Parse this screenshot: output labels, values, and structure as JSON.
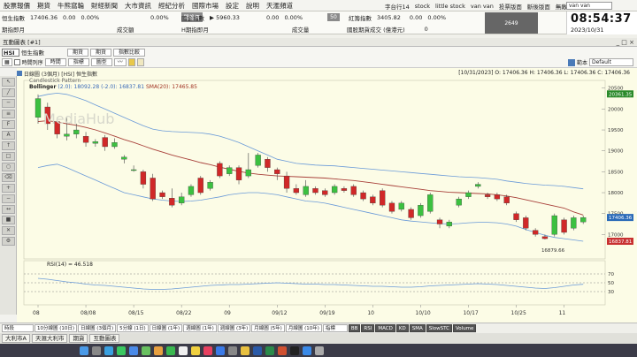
{
  "menu": {
    "items": [
      "股票報價",
      "期貨",
      "牛熊窩輪",
      "財經新聞",
      "大市資訊",
      "經紀分析",
      "國際市場",
      "設定",
      "說明",
      "天滙頻道"
    ],
    "right_items": [
      "字台行14",
      "stock",
      "little stock",
      "van van",
      "投票版面",
      "斷後版面",
      "無敵版面"
    ],
    "search_value": "van van"
  },
  "quotes": {
    "row1": {
      "index_name": "恒生指數",
      "last": "17406.36",
      "change": "0.00",
      "pct": "0.00%",
      "pct2": "0.00%",
      "pre_label": "開盤價",
      "futures_label": "國企指數",
      "futures_value": "▶ 5960.33",
      "f_change": "0.00",
      "f_pct": "0.00%",
      "vol_badge": "50",
      "red_label": "紅籌指數",
      "red_value": "3405.82",
      "r_change": "0.00",
      "r_pct": "0.00%"
    },
    "row2": {
      "label1": "期指即月",
      "amount_label": "成交額",
      "label2": "H期指即月",
      "vol_label": "成交量",
      "label3": "國股期貨成交 (億港元)",
      "value3": "0"
    },
    "dark_value": "2649"
  },
  "clock": {
    "time": "08:54:37",
    "date": "2023/10/31"
  },
  "window": {
    "title": "互動圖表 [#1]",
    "controls": "_ □ ×"
  },
  "toolbar": {
    "symbol": "HSI",
    "name": "恒生指數",
    "btn1": "期貨",
    "btn2": "期貨",
    "btn3": "指數比較",
    "time_axis": "時間列序",
    "b_time": "時間",
    "b_indicator": "指標",
    "b_chart": "圖型",
    "right_label": "範本",
    "template": "Default"
  },
  "chart": {
    "header_left": "日線圖 (3個月)",
    "header_code": "[HSI] 恒生指數",
    "ohlc": "[10/31/2023]  O: 17406.36  H: 17406.36  L: 17406.36  C: 17406.36",
    "sub": "Candlestick Pattern",
    "boll_label": "Bollinger",
    "boll_upper": "(2.0): 18092.28",
    "boll_lower": "(-2.0): 16837.81",
    "sma_label": "SMA(20): 17465.85",
    "watermark": "MediaHub",
    "low_annot": "16879.66",
    "rsi_label": "RSI(14) = 46.518"
  },
  "chart_data": {
    "type": "candlestick",
    "x_labels": [
      "08",
      "08/08",
      "08/15",
      "08/22",
      "09",
      "09/12",
      "09/19",
      "10",
      "10/10",
      "10/17",
      "10/25",
      "11"
    ],
    "y_ticks": [
      20500,
      20000,
      19500,
      19000,
      18500,
      18000,
      17500,
      17000
    ],
    "ylim": [
      16500,
      20600
    ],
    "price_tags": [
      {
        "value": "20361.35",
        "color": "#2a8a2a"
      },
      {
        "value": "17406.36",
        "color": "#2a6ab8"
      },
      {
        "value": "16837.81",
        "color": "#c83030"
      }
    ],
    "candles": [
      {
        "o": 19800,
        "c": 20250,
        "h": 20350,
        "l": 19650
      },
      {
        "o": 20050,
        "c": 19650,
        "h": 20150,
        "l": 19500
      },
      {
        "o": 19700,
        "c": 19400,
        "h": 19800,
        "l": 19300
      },
      {
        "o": 19350,
        "c": 19400,
        "h": 19800,
        "l": 19250
      },
      {
        "o": 19400,
        "c": 19500,
        "h": 19650,
        "l": 19300
      },
      {
        "o": 19350,
        "c": 19200,
        "h": 19450,
        "l": 19100
      },
      {
        "o": 19180,
        "c": 19220,
        "h": 19280,
        "l": 19100
      },
      {
        "o": 19320,
        "c": 19100,
        "h": 19380,
        "l": 19000
      },
      {
        "o": 19100,
        "c": 19200,
        "h": 19300,
        "l": 19050
      },
      {
        "o": 18800,
        "c": 18850,
        "h": 18900,
        "l": 18700
      },
      {
        "o": 18550,
        "c": 18550,
        "h": 18650,
        "l": 18500
      },
      {
        "o": 18500,
        "c": 18200,
        "h": 18550,
        "l": 18100
      },
      {
        "o": 18350,
        "c": 17850,
        "h": 18450,
        "l": 17800
      },
      {
        "o": 18000,
        "c": 17900,
        "h": 18050,
        "l": 17850
      },
      {
        "o": 17870,
        "c": 17700,
        "h": 18100,
        "l": 17650
      },
      {
        "o": 17750,
        "c": 17900,
        "h": 18000,
        "l": 17700
      },
      {
        "o": 17950,
        "c": 18150,
        "h": 18200,
        "l": 17900
      },
      {
        "o": 18350,
        "c": 18000,
        "h": 18400,
        "l": 17950
      },
      {
        "o": 18100,
        "c": 18250,
        "h": 18300,
        "l": 18050
      },
      {
        "o": 18700,
        "c": 18400,
        "h": 18750,
        "l": 18350
      },
      {
        "o": 18450,
        "c": 18600,
        "h": 18650,
        "l": 18400
      },
      {
        "o": 18600,
        "c": 18300,
        "h": 18650,
        "l": 18200
      },
      {
        "o": 18400,
        "c": 18550,
        "h": 18950,
        "l": 18350
      },
      {
        "o": 18650,
        "c": 18900,
        "h": 18950,
        "l": 18600
      },
      {
        "o": 18800,
        "c": 18600,
        "h": 18850,
        "l": 18500
      },
      {
        "o": 18550,
        "c": 18450,
        "h": 18600,
        "l": 18300
      },
      {
        "o": 18400,
        "c": 18100,
        "h": 18500,
        "l": 18000
      },
      {
        "o": 18100,
        "c": 18000,
        "h": 18200,
        "l": 17950
      },
      {
        "o": 17950,
        "c": 18150,
        "h": 18300,
        "l": 17900
      },
      {
        "o": 18100,
        "c": 18000,
        "h": 18150,
        "l": 17950
      },
      {
        "o": 18050,
        "c": 17950,
        "h": 18100,
        "l": 17900
      },
      {
        "o": 18000,
        "c": 18150,
        "h": 18200,
        "l": 17950
      },
      {
        "o": 18100,
        "c": 18050,
        "h": 18150,
        "l": 18000
      },
      {
        "o": 18150,
        "c": 17950,
        "h": 18200,
        "l": 17900
      },
      {
        "o": 18000,
        "c": 17850,
        "h": 18050,
        "l": 17800
      },
      {
        "o": 17900,
        "c": 17750,
        "h": 17950,
        "l": 17700
      },
      {
        "o": 18050,
        "c": 17700,
        "h": 18100,
        "l": 17650
      },
      {
        "o": 17750,
        "c": 17550,
        "h": 17800,
        "l": 17500
      },
      {
        "o": 17600,
        "c": 17750,
        "h": 17800,
        "l": 17550
      },
      {
        "o": 17600,
        "c": 17400,
        "h": 17650,
        "l": 17350
      },
      {
        "o": 17450,
        "c": 17700,
        "h": 17750,
        "l": 17400
      },
      {
        "o": 17550,
        "c": 17950,
        "h": 18000,
        "l": 17500
      },
      {
        "o": 17350,
        "c": 17250,
        "h": 17400,
        "l": 17150
      },
      {
        "o": 17200,
        "c": 17300,
        "h": 17350,
        "l": 17150
      },
      {
        "o": 17700,
        "c": 17850,
        "h": 17900,
        "l": 17650
      },
      {
        "o": 17900,
        "c": 18000,
        "h": 18050,
        "l": 17850
      },
      {
        "o": 18150,
        "c": 18200,
        "h": 18250,
        "l": 18100
      },
      {
        "o": 17950,
        "c": 17900,
        "h": 18000,
        "l": 17850
      },
      {
        "o": 17950,
        "c": 17850,
        "h": 18000,
        "l": 17800
      },
      {
        "o": 17900,
        "c": 17750,
        "h": 17950,
        "l": 17700
      },
      {
        "o": 17500,
        "c": 17350,
        "h": 17550,
        "l": 17300
      },
      {
        "o": 17400,
        "c": 17150,
        "h": 17450,
        "l": 17100
      },
      {
        "o": 17100,
        "c": 17000,
        "h": 17150,
        "l": 16950
      },
      {
        "o": 16950,
        "c": 16900,
        "h": 17000,
        "l": 16880
      },
      {
        "o": 17000,
        "c": 17450,
        "h": 17500,
        "l": 16950
      },
      {
        "o": 17350,
        "c": 17050,
        "h": 17400,
        "l": 17000
      },
      {
        "o": 17150,
        "c": 17400,
        "h": 17450,
        "l": 17100
      },
      {
        "o": 17300,
        "c": 17406,
        "h": 17450,
        "l": 17250
      }
    ],
    "sma": [
      19700,
      19720,
      19690,
      19650,
      19610,
      19560,
      19500,
      19430,
      19350,
      19270,
      19200,
      19120,
      19040,
      18970,
      18900,
      18840,
      18780,
      18720,
      18670,
      18610,
      18560,
      18510,
      18470,
      18440,
      18420,
      18400,
      18390,
      18380,
      18370,
      18360,
      18350,
      18330,
      18310,
      18290,
      18260,
      18230,
      18200,
      18170,
      18140,
      18110,
      18080,
      18050,
      18030,
      18010,
      18000,
      17990,
      17980,
      17970,
      17950,
      17920,
      17880,
      17830,
      17780,
      17730,
      17680,
      17630,
      17540,
      17466
    ],
    "boll_upper": [
      20300,
      20350,
      20380,
      20350,
      20280,
      20200,
      20100,
      20000,
      19900,
      19800,
      19700,
      19600,
      19520,
      19480,
      19460,
      19450,
      19440,
      19430,
      19400,
      19350,
      19280,
      19200,
      19100,
      19000,
      18900,
      18800,
      18750,
      18700,
      18680,
      18660,
      18650,
      18640,
      18620,
      18600,
      18580,
      18560,
      18540,
      18520,
      18500,
      18480,
      18460,
      18440,
      18420,
      18400,
      18380,
      18370,
      18360,
      18340,
      18320,
      18280,
      18250,
      18220,
      18200,
      18180,
      18170,
      18150,
      18120,
      18092
    ],
    "boll_lower": [
      18600,
      18650,
      18680,
      18600,
      18500,
      18400,
      18300,
      18200,
      18100,
      18000,
      17950,
      17900,
      17850,
      17820,
      17800,
      17790,
      17800,
      17820,
      17860,
      17900,
      17950,
      17980,
      18000,
      18000,
      17980,
      17950,
      17900,
      17850,
      17800,
      17780,
      17750,
      17700,
      17650,
      17600,
      17550,
      17500,
      17450,
      17400,
      17350,
      17320,
      17300,
      17280,
      17260,
      17250,
      17260,
      17280,
      17290,
      17290,
      17280,
      17250,
      17200,
      17120,
      17050,
      16980,
      16930,
      16900,
      16870,
      16838
    ],
    "rsi": {
      "label": "RSI(14)",
      "levels": [
        70,
        50,
        30
      ],
      "values": [
        60,
        58,
        55,
        52,
        50,
        47,
        45,
        44,
        42,
        40,
        38,
        36,
        35,
        35,
        36,
        38,
        40,
        42,
        44,
        45,
        46,
        46,
        47,
        48,
        49,
        50,
        49,
        48,
        47,
        47,
        46,
        46,
        45,
        44,
        43,
        42,
        42,
        41,
        40,
        40,
        41,
        43,
        44,
        45,
        46,
        47,
        48,
        47,
        46,
        44,
        42,
        40,
        38,
        37,
        39,
        42,
        45,
        46.518
      ]
    }
  },
  "bottombar": {
    "left": "時段",
    "tabs": [
      "10分線圖 (10日)",
      "日線圖 (3個月)",
      "5分線 (1日)",
      "日線圖 (1年)",
      "週線圖 (1年)",
      "週線圖 (3年)",
      "月線圖 (5年)",
      "月線圖 (10年)"
    ],
    "indicators": [
      "指標",
      "BB",
      "RSI",
      "MACD",
      "KD",
      "SMA",
      "SlowSTC",
      "Volume"
    ]
  },
  "taskbar": {
    "items": [
      "大利市A",
      "天滙大利市",
      "期貨",
      "互動圖表"
    ]
  }
}
